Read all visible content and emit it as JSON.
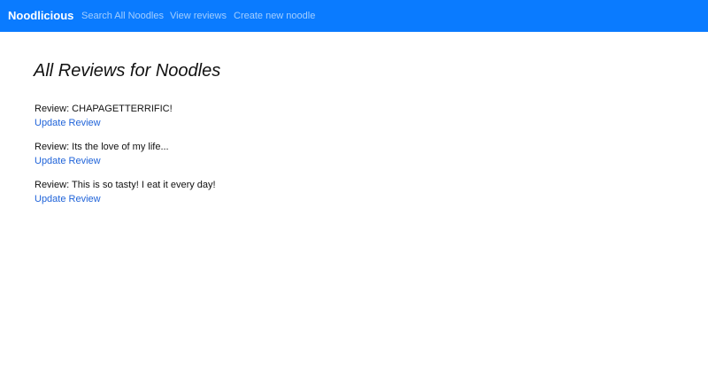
{
  "navbar": {
    "brand": "Noodlicious",
    "links": [
      {
        "label": "Search All Noodles"
      },
      {
        "label": "View reviews"
      },
      {
        "label": "Create new noodle"
      }
    ]
  },
  "main": {
    "title": "All Reviews for Noodles",
    "reviews": [
      {
        "text": "Review: CHAPAGETTERRIFIC!",
        "link_label": "Update Review"
      },
      {
        "text": "Review: Its the love of my life...",
        "link_label": "Update Review"
      },
      {
        "text": "Review: This is so tasty! I eat it every day!",
        "link_label": "Update Review"
      }
    ]
  },
  "colors": {
    "navbar_bg": "#0a7bff",
    "link": "#1f63d9"
  }
}
